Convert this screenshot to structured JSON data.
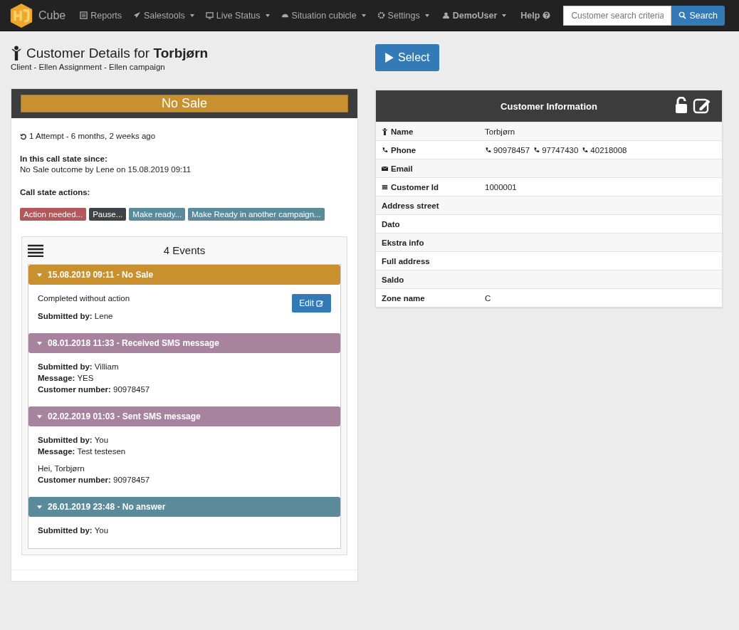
{
  "nav": {
    "brand": "Cube",
    "items": [
      {
        "label": "Reports",
        "dropdown": false
      },
      {
        "label": "Salestools",
        "dropdown": true
      },
      {
        "label": "Live Status",
        "dropdown": true
      },
      {
        "label": "Situation cubicle",
        "dropdown": true
      },
      {
        "label": "Settings",
        "dropdown": true
      }
    ],
    "right": [
      {
        "label": "DemoUser",
        "dropdown": true
      },
      {
        "label": "Help",
        "dropdown": false
      }
    ],
    "search": {
      "placeholder": "Customer search criteria",
      "button": "Search"
    }
  },
  "header": {
    "title": "Customer Details for **Torbjørn**",
    "subtitle": "Client - Ellen Assignment - Ellen campaign",
    "select_button": "Select"
  },
  "status": {
    "label": "No Sale",
    "color": "#c8902e"
  },
  "attempts": "1 Attempt - 6 months, 2 weeks ago",
  "since": {
    "label": "In this call state since:",
    "text": "No Sale outcome by Lene on 15.08.2019 09:11"
  },
  "actions_label": "Call state actions:",
  "actions": [
    {
      "label": "Action needed...",
      "color": "#b0585a"
    },
    {
      "label": "Pause...",
      "color": "#3f4347"
    },
    {
      "label": "Make ready...",
      "color": "#5b8a9b"
    },
    {
      "label": "Make Ready in another campaign...",
      "color": "#5b8a9b"
    }
  ],
  "events": {
    "title": "4 Events",
    "items": [
      {
        "header": "15.08.2019 09:11 - No Sale",
        "color": "#c8902e",
        "edit_button": "Edit",
        "paragraphs": [
          [
            "Completed without action"
          ],
          [
            "**Submitted by:** Lene"
          ]
        ]
      },
      {
        "header": "08.01.2018 11:33 - Received SMS message",
        "color": "#a7839d",
        "paragraphs": [
          [
            "**Submitted by:** Villiam",
            "**Message:** YES",
            "**Customer number:** 90978457"
          ]
        ]
      },
      {
        "header": "02.02.2019 01:03 - Sent SMS message",
        "color": "#a7839d",
        "paragraphs": [
          [
            "**Submitted by:** You",
            "**Message:** Test testesen"
          ],
          [
            "Hei, Torbjørn",
            "**Customer number:** 90978457"
          ]
        ]
      },
      {
        "header": "26.01.2019 23:48 - No answer",
        "color": "#5b8a9b",
        "paragraphs": [
          [
            "**Submitted by:** You"
          ]
        ]
      }
    ]
  },
  "customer_info": {
    "title": "Customer Information",
    "rows": [
      {
        "label": "Name",
        "values": [
          "Torbjørn"
        ]
      },
      {
        "label": "Phone",
        "values": [
          "90978457",
          "97747430",
          "40218008"
        ]
      },
      {
        "label": "Email"
      },
      {
        "label": "Customer Id",
        "values": [
          "1000001"
        ]
      },
      {
        "label": "Address street"
      },
      {
        "label": "Dato"
      },
      {
        "label": "Ekstra info"
      },
      {
        "label": "Full address"
      },
      {
        "label": "Saldo"
      },
      {
        "label": "Zone name",
        "values": [
          "C"
        ]
      }
    ]
  }
}
